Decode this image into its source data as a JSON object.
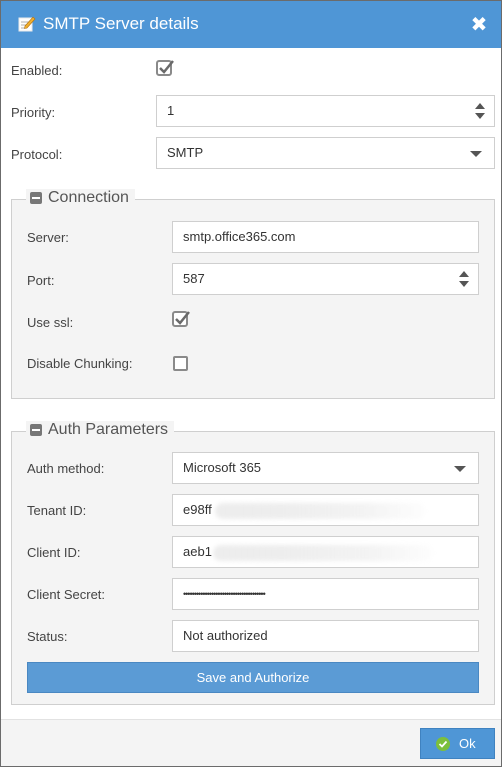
{
  "dialog": {
    "title": "SMTP Server details",
    "title_icon": "edit-note-icon",
    "close_icon": "close-icon"
  },
  "general": {
    "enabled_label": "Enabled:",
    "enabled_checked": true,
    "priority_label": "Priority:",
    "priority_value": "1",
    "protocol_label": "Protocol:",
    "protocol_value": "SMTP"
  },
  "connection": {
    "legend": "Connection",
    "server_label": "Server:",
    "server_value": "smtp.office365.com",
    "port_label": "Port:",
    "port_value": "587",
    "use_ssl_label": "Use ssl:",
    "use_ssl_checked": true,
    "disable_chunking_label": "Disable Chunking:",
    "disable_chunking_checked": false
  },
  "auth": {
    "legend": "Auth Parameters",
    "method_label": "Auth method:",
    "method_value": "Microsoft 365",
    "tenant_label": "Tenant ID:",
    "tenant_value": "e98ff",
    "client_id_label": "Client ID:",
    "client_id_value": "aeb1",
    "client_secret_label": "Client Secret:",
    "client_secret_value": "••••••••••••••••••••••••••••••••••••••",
    "status_label": "Status:",
    "status_value": "Not authorized",
    "authorize_button": "Save and Authorize"
  },
  "footer": {
    "ok_label": "Ok",
    "ok_icon": "check-circle-icon"
  },
  "colors": {
    "titlebar": "#4f96d6",
    "primary_button": "#5b9bd5",
    "ok_icon_green": "#7cbf3c"
  }
}
